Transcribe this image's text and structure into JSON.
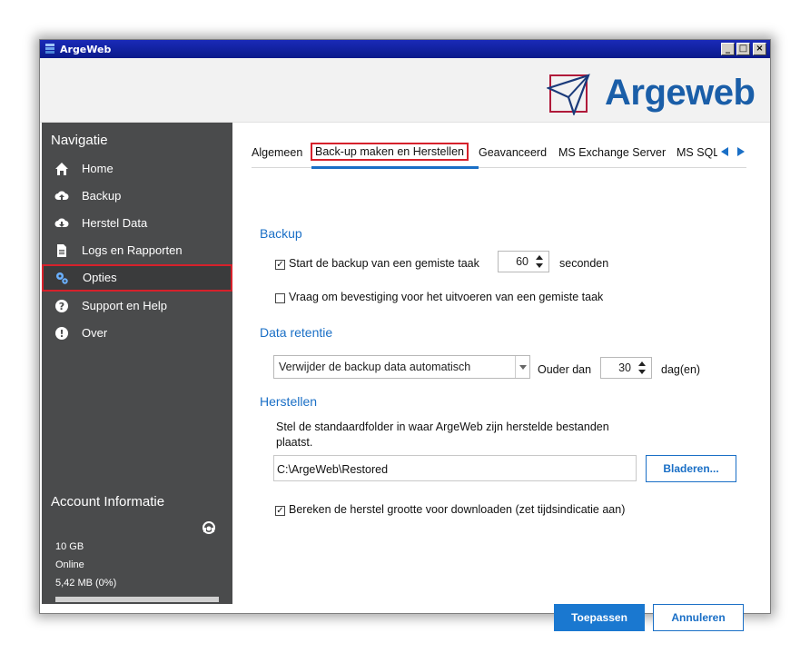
{
  "window": {
    "title": "ArgeWeb"
  },
  "header": {
    "logo_text": "Argeweb",
    "brand_color": "#1a5ea8"
  },
  "nav": {
    "title": "Navigatie",
    "items": [
      {
        "label": "Home",
        "icon": "home-icon"
      },
      {
        "label": "Backup",
        "icon": "cloud-upload-icon"
      },
      {
        "label": "Herstel Data",
        "icon": "cloud-download-icon"
      },
      {
        "label": "Logs en Rapporten",
        "icon": "document-icon"
      },
      {
        "label": "Opties",
        "icon": "gears-icon",
        "active": true
      },
      {
        "label": "Support en Help",
        "icon": "question-icon"
      },
      {
        "label": "Over",
        "icon": "info-icon"
      }
    ]
  },
  "account": {
    "title": "Account Informatie",
    "quota": "10 GB",
    "status": "Online",
    "usage": "5,42 MB (0%)",
    "usage_fraction": 0.0
  },
  "tabs": [
    {
      "label": "Algemeen"
    },
    {
      "label": "Back-up maken en Herstellen",
      "active": true
    },
    {
      "label": "Geavanceerd"
    },
    {
      "label": "MS Exchange Server"
    },
    {
      "label": "MS SQL Server"
    }
  ],
  "backup": {
    "title": "Backup",
    "start_missed_label": "Start de backup van een gemiste taak",
    "start_missed_checked": true,
    "start_missed_value": "60",
    "start_missed_unit": "seconden",
    "confirm_label": "Vraag om bevestiging voor het uitvoeren van een gemiste taak",
    "confirm_checked": false
  },
  "retention": {
    "title": "Data retentie",
    "select_value": "Verwijder de backup data automatisch",
    "older_than_label": "Ouder dan",
    "older_than_value": "30",
    "unit": "dag(en)"
  },
  "restore": {
    "title": "Herstellen",
    "description_line1": "Stel de standaardfolder in waar ArgeWeb zijn herstelde bestanden",
    "description_line2": "plaatst.",
    "path_value": "C:\\ArgeWeb\\Restored",
    "browse_label": "Bladeren...",
    "calc_size_label": "Bereken de herstel grootte voor downloaden (zet tijdsindicatie aan)",
    "calc_size_checked": true
  },
  "footer": {
    "apply_label": "Toepassen",
    "cancel_label": "Annuleren"
  }
}
